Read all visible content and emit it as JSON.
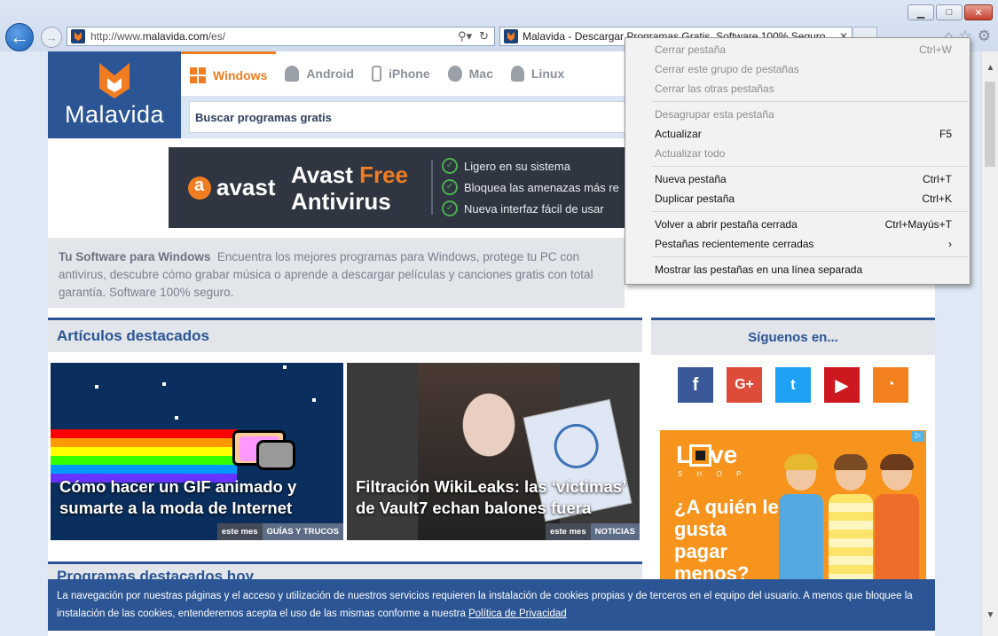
{
  "browser": {
    "url_prefix": "http://www.",
    "url_domain": "malavida.com",
    "url_path": "/es/",
    "tab_title": "Malavida - Descargar Programas Gratis, Software 100% Seguro"
  },
  "site": {
    "logo_text": "Malavida",
    "nav": [
      {
        "label": "Windows"
      },
      {
        "label": "Android"
      },
      {
        "label": "iPhone"
      },
      {
        "label": "Mac"
      },
      {
        "label": "Linux"
      }
    ],
    "search_placeholder": "Buscar programas gratis"
  },
  "avast_ad": {
    "brand": "avast",
    "title_a": "Avast ",
    "title_b": "Free",
    "title_c": "Antivirus",
    "features": [
      "Ligero en su sistema",
      "Bloquea las amenazas más re",
      "Nueva interfaz fácil de usar"
    ]
  },
  "intro": {
    "lead": "Tu Software para Windows",
    "text": "Encuentra los mejores programas para Windows, protege tu PC con antivirus, descubre cómo grabar música o aprende a descargar películas y canciones gratis con total garantía. Software 100% seguro."
  },
  "articles": {
    "title": "Artículos destacados",
    "items": [
      {
        "caption": "Cómo hacer un GIF animado y sumarte a la moda de Internet",
        "time": "este mes",
        "category": "GUÍAS Y TRUCOS"
      },
      {
        "caption": "Filtración WikiLeaks: las ‘víctimas’ de Vault7 echan balones fuera",
        "time": "este mes",
        "category": "NOTICIAS"
      }
    ]
  },
  "follow": {
    "title": "Síguenos en...",
    "networks": [
      {
        "glyph": "f",
        "icon": "facebook-icon"
      },
      {
        "glyph": "G+",
        "icon": "google-plus-icon"
      },
      {
        "glyph": "t",
        "icon": "twitter-icon"
      },
      {
        "glyph": "▶",
        "icon": "youtube-icon"
      },
      {
        "glyph": "◔",
        "icon": "rss-icon"
      }
    ]
  },
  "love_ad": {
    "brand_a": "L",
    "brand_b": "ve",
    "sub": "S H O P",
    "question": "¿A quién le gusta pagar menos?"
  },
  "programas_title": "Programas destacados hoy",
  "cookie": {
    "text": "La navegación por nuestras páginas y el acceso y utilización de nuestros servicios requieren la instalación de cookies propias y de terceros en el equipo del usuario. A menos que bloquee la instalación de las cookies, entenderemos acepta el uso de las mismas conforme a nuestra ",
    "link": "Política de Privacidad"
  },
  "context_menu": {
    "groups": [
      [
        {
          "label": "Cerrar pestaña",
          "shortcut": "Ctrl+W",
          "disabled": true
        },
        {
          "label": "Cerrar este grupo de pestañas",
          "shortcut": "",
          "disabled": true
        },
        {
          "label": "Cerrar las otras pestañas",
          "shortcut": "",
          "disabled": true
        }
      ],
      [
        {
          "label": "Desagrupar esta pestaña",
          "shortcut": "",
          "disabled": true
        },
        {
          "label": "Actualizar",
          "shortcut": "F5",
          "disabled": false
        },
        {
          "label": "Actualizar todo",
          "shortcut": "",
          "disabled": true
        }
      ],
      [
        {
          "label": "Nueva pestaña",
          "shortcut": "Ctrl+T",
          "disabled": false
        },
        {
          "label": "Duplicar pestaña",
          "shortcut": "Ctrl+K",
          "disabled": false
        }
      ],
      [
        {
          "label": "Volver a abrir pestaña cerrada",
          "shortcut": "Ctrl+Mayús+T",
          "disabled": false
        },
        {
          "label": "Pestañas recientemente cerradas",
          "shortcut": "›",
          "disabled": false
        }
      ],
      [
        {
          "label": "Mostrar las pestañas en una línea separada",
          "shortcut": "",
          "disabled": false
        }
      ]
    ]
  },
  "colors": {
    "brand_blue": "#2b5594",
    "brand_orange": "#f07d22",
    "avast_bg": "#2f3541"
  }
}
